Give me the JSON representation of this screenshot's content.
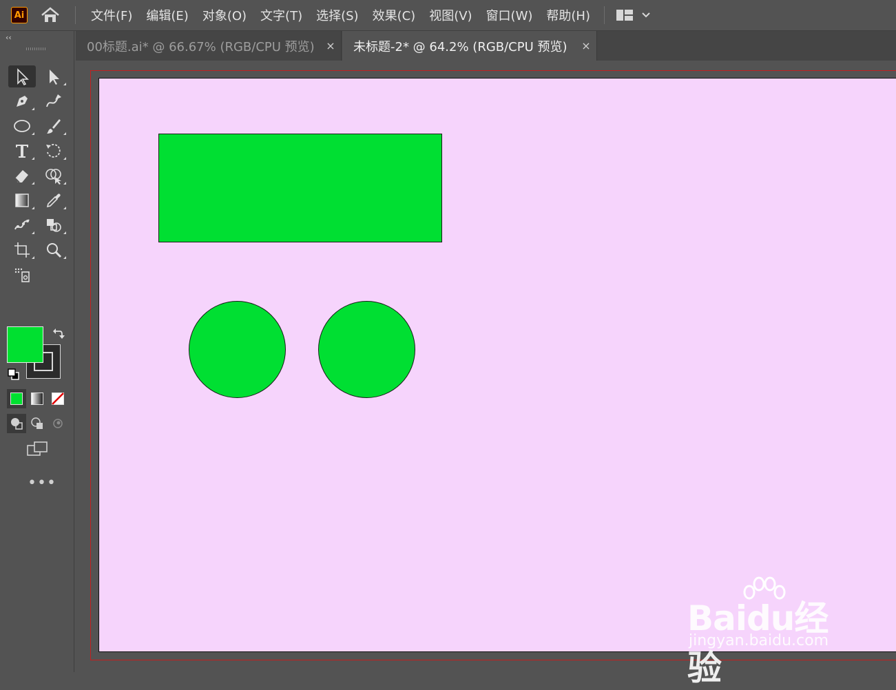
{
  "app": {
    "logo_text": "Ai"
  },
  "menu": {
    "items": [
      "文件(F)",
      "编辑(E)",
      "对象(O)",
      "文字(T)",
      "选择(S)",
      "效果(C)",
      "视图(V)",
      "窗口(W)",
      "帮助(H)"
    ]
  },
  "toolbar": {
    "collapse_label": "‹‹",
    "more_label": "•••"
  },
  "tabs": [
    {
      "label": "00标题.ai* @ 66.67% (RGB/CPU 预览)",
      "close": "×",
      "active": false
    },
    {
      "label": "未标题-2* @ 64.2% (RGB/CPU 预览)",
      "close": "×",
      "active": true
    }
  ],
  "colors": {
    "fill": "#00e030",
    "artboard_bg": "#f6d4fc",
    "shape_fill": "#00df32",
    "bleed_line": "#c32020"
  },
  "watermark": {
    "brand": "Baidu经验",
    "url": "jingyan.baidu.com"
  }
}
